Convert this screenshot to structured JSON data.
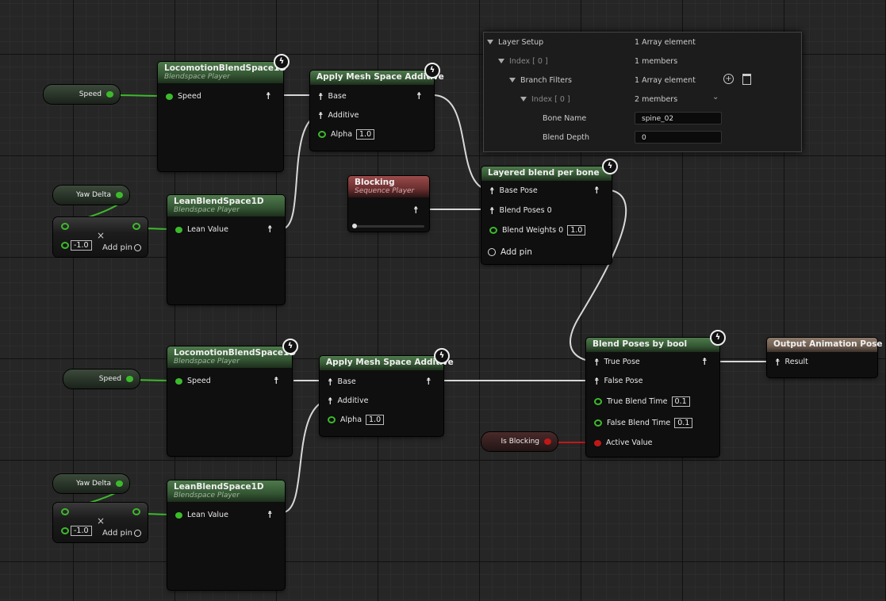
{
  "details": {
    "rows": [
      {
        "label": "Layer Setup",
        "value": "1 Array element"
      },
      {
        "label": "Index [ 0 ]",
        "value": "1 members"
      },
      {
        "label": "Branch Filters",
        "value": "1 Array element"
      },
      {
        "label": "Index [ 0 ]",
        "value": "2 members"
      },
      {
        "label": "Bone Name",
        "value": "spine_02"
      },
      {
        "label": "Blend Depth",
        "value": "0"
      }
    ]
  },
  "nodes": {
    "loco1": {
      "title": "LocomotionBlendSpace1D",
      "subtitle": "Blendspace Player",
      "pin": "Speed"
    },
    "apply1": {
      "title": "Apply Mesh Space Additive",
      "base": "Base",
      "additive": "Additive",
      "alpha": "Alpha",
      "alpha_value": "1.0"
    },
    "lean1": {
      "title": "LeanBlendSpace1D",
      "subtitle": "Blendspace Player",
      "pin": "Lean Value"
    },
    "blocking": {
      "title": "Blocking",
      "subtitle": "Sequence Player"
    },
    "layered": {
      "title": "Layered blend per bone",
      "base": "Base Pose",
      "blend_poses": "Blend Poses 0",
      "blend_weights": "Blend Weights 0",
      "weights_value": "1.0",
      "add_pin": "Add pin"
    },
    "loco2": {
      "title": "LocomotionBlendSpace1D",
      "subtitle": "Blendspace Player",
      "pin": "Speed"
    },
    "apply2": {
      "title": "Apply Mesh Space Additive",
      "base": "Base",
      "additive": "Additive",
      "alpha": "Alpha",
      "alpha_value": "1.0"
    },
    "lean2": {
      "title": "LeanBlendSpace1D",
      "subtitle": "Blendspace Player",
      "pin": "Lean Value"
    },
    "blendbool": {
      "title": "Blend Poses by bool",
      "true_pose": "True Pose",
      "false_pose": "False Pose",
      "true_time": "True Blend Time",
      "true_time_value": "0.1",
      "false_time": "False Blend Time",
      "false_time_value": "0.1",
      "active": "Active Value"
    },
    "output": {
      "title": "Output Animation Pose",
      "result": "Result"
    }
  },
  "variables": {
    "speed1": "Speed",
    "yaw1": "Yaw Delta",
    "speed2": "Speed",
    "yaw2": "Yaw Delta",
    "isblocking": "Is Blocking"
  },
  "multiply": {
    "value": "-1.0",
    "add_pin": "Add pin"
  },
  "colors": {
    "exec_green": "#3dba2c",
    "bool_red": "#c01818",
    "wire_white": "#d8d8d8"
  }
}
